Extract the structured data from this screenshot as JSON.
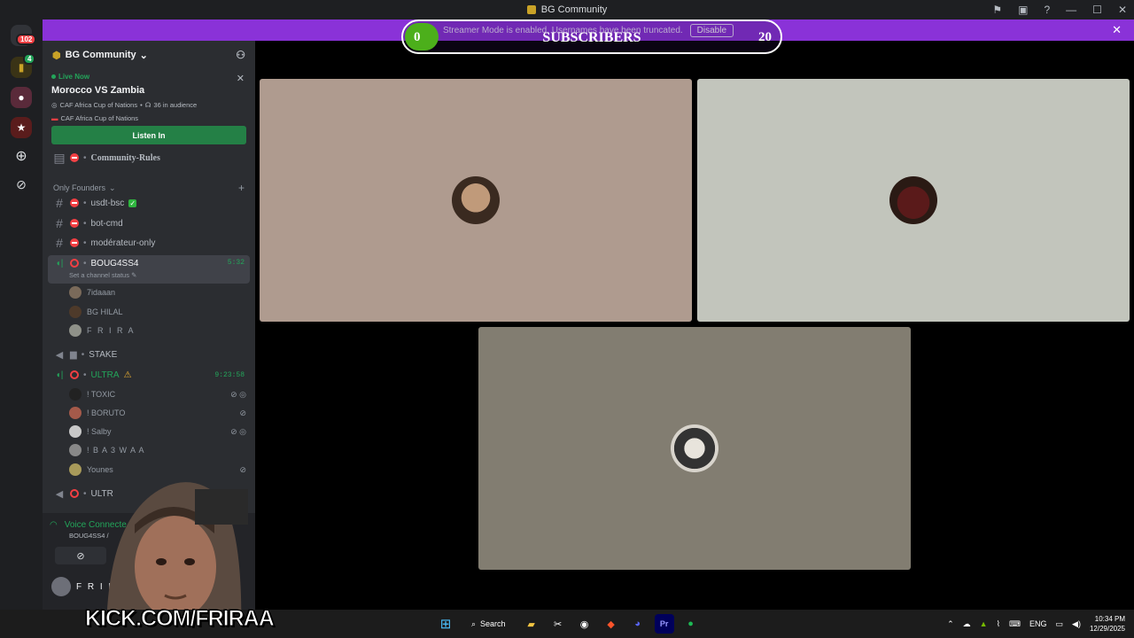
{
  "window": {
    "title": "BG Community"
  },
  "banner": {
    "text": "Streamer Mode is enabled. Usernames have been truncated.",
    "disable_label": "Disable"
  },
  "subscribers": {
    "label": "SUBSCRIBERS",
    "current": "0",
    "goal": "20",
    "progress": 0.0
  },
  "server_rail": {
    "badge": "102",
    "badge_small": "4"
  },
  "sidebar": {
    "server_name": "BG Community",
    "live": {
      "status": "Live Now",
      "stage_title": "Morocco VS Zambia",
      "meta": "CAF Africa Cup of Nations",
      "audience": "36 in audience",
      "host": "CAF Africa Cup of Nations",
      "listen_label": "Listen In"
    },
    "channels": {
      "community_rules": "Community-Rules",
      "category": "Only Founders",
      "usdt": "usdt-bsc",
      "bot": "bot-cmd",
      "mod": "modérateur-only",
      "voice1": {
        "name": "BOUG4SS4",
        "time": "5:32",
        "status": "Set a channel status"
      },
      "voice1_users": [
        "7idaaan",
        "BG HILAL",
        "F R I R A"
      ],
      "stake": "STAKE",
      "voice2": {
        "name": "ULTRA",
        "time": "9:23:58"
      },
      "voice2_users": [
        "! TOXIC",
        "! BORUTO",
        "! Salby",
        "! B A 3 W A A",
        "Younes"
      ],
      "voice3": "ULTR"
    },
    "voice_panel": {
      "connected": "Voice Connecte",
      "channel": "BOUG4SS4 /",
      "user": "F R I R"
    }
  },
  "tiles": {
    "colors": [
      "#af9b8f",
      "#c2c5bc",
      "#827d71"
    ]
  },
  "overlay": {
    "kick_text": "KICK.COM/FRIRAA"
  },
  "taskbar": {
    "search_label": "Search",
    "lang": "ENG",
    "time": "10:34 PM",
    "date": "12/29/2025"
  }
}
